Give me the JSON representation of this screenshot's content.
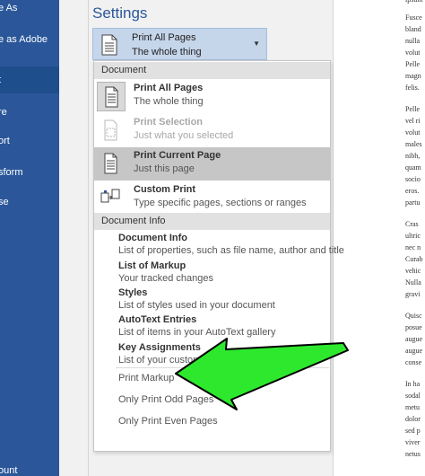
{
  "sidebar": {
    "items": [
      {
        "label": "e As"
      },
      {
        "label": "e as Adobe"
      },
      {
        "label": "t"
      },
      {
        "label": "re"
      },
      {
        "label": "ort"
      },
      {
        "label": "sform"
      },
      {
        "label": "se"
      },
      {
        "label": "ount"
      }
    ]
  },
  "settings": {
    "title": "Settings",
    "selector": {
      "line1": "Print All Pages",
      "line2": "The whole thing"
    }
  },
  "dropdown": {
    "document_header": "Document",
    "options": [
      {
        "title": "Print All Pages",
        "subtitle": "The whole thing"
      },
      {
        "title": "Print Selection",
        "subtitle": "Just what you selected"
      },
      {
        "title": "Print Current Page",
        "subtitle": "Just this page"
      },
      {
        "title": "Custom Print",
        "subtitle": "Type specific pages, sections or ranges"
      }
    ],
    "info_header": "Document Info",
    "info_items": [
      {
        "title": "Document Info",
        "subtitle": "List of properties, such as file name, author and title"
      },
      {
        "title": "List of Markup",
        "subtitle": "Your tracked changes"
      },
      {
        "title": "Styles",
        "subtitle": "List of styles used in your document"
      },
      {
        "title": "AutoText Entries",
        "subtitle": "List of items in your AutoText gallery"
      },
      {
        "title": "Key Assignments",
        "subtitle": "List of your custom shortcut keys"
      }
    ],
    "extra_items": [
      {
        "label": "Print Markup"
      },
      {
        "label": "Only Print Odd Pages"
      },
      {
        "label": "Only Print Even Pages"
      }
    ]
  },
  "document": {
    "paragraphs": [
      {
        "lines": [
          "ipsum"
        ]
      },
      {
        "lines": [
          "Fusce",
          "bland",
          "nulla",
          "volut",
          "Pelle",
          "magn",
          "felis."
        ]
      },
      {
        "lines": [
          "Pelle",
          "vel ri",
          "volut",
          "males",
          "nibh,",
          "quam",
          "socio",
          "eros.",
          "partu"
        ]
      },
      {
        "lines": [
          "Cras",
          "ultric",
          "nec n",
          "Curab",
          "vehic",
          "Nulla",
          "gravi"
        ]
      },
      {
        "lines": [
          "Quisc",
          "posue",
          "augue",
          "augue",
          "conse"
        ]
      },
      {
        "lines": [
          "In ha",
          "sodal",
          "metu",
          "dolor",
          "sed p",
          "viver",
          "netus"
        ]
      }
    ]
  },
  "colors": {
    "sidebar": "#2b579a",
    "accent": "#2b579a",
    "selected_option": "#c6c6c6",
    "arrow": "#2ee82e"
  }
}
